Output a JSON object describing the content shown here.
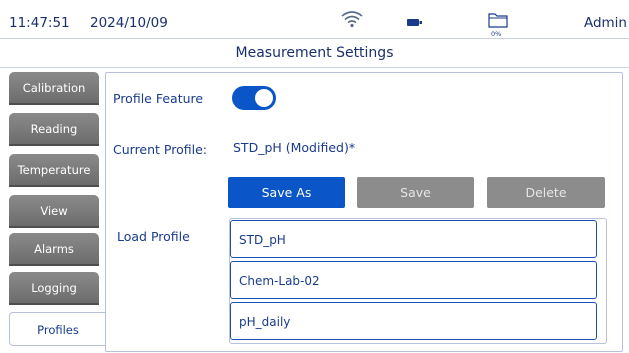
{
  "status": {
    "time": "11:47:51",
    "date": "2024/10/09",
    "storage_percent": "0%",
    "user": "Admin"
  },
  "title": "Measurement Settings",
  "sidebar": {
    "items": [
      {
        "label": "Calibration"
      },
      {
        "label": "Reading"
      },
      {
        "label": "Temperature"
      },
      {
        "label": "View"
      },
      {
        "label": "Alarms"
      },
      {
        "label": "Logging"
      },
      {
        "label": "Profiles"
      }
    ],
    "active": "Profiles"
  },
  "profiles": {
    "feature_label": "Profile Feature",
    "feature_enabled": true,
    "current_label": "Current Profile:",
    "current_value": "STD_pH (Modified)*",
    "buttons": {
      "save_as": "Save As",
      "save": "Save",
      "delete": "Delete"
    },
    "load_label": "Load Profile",
    "list": [
      "STD_pH",
      "Chem-Lab-02",
      "pH_daily"
    ]
  },
  "colors": {
    "accent": "#0a56c8",
    "tab_inactive": "#7a7a7a",
    "text": "#1a3b8c"
  },
  "icons": {
    "wifi": "wifi-icon",
    "battery": "battery-icon",
    "folder": "folder-icon"
  }
}
